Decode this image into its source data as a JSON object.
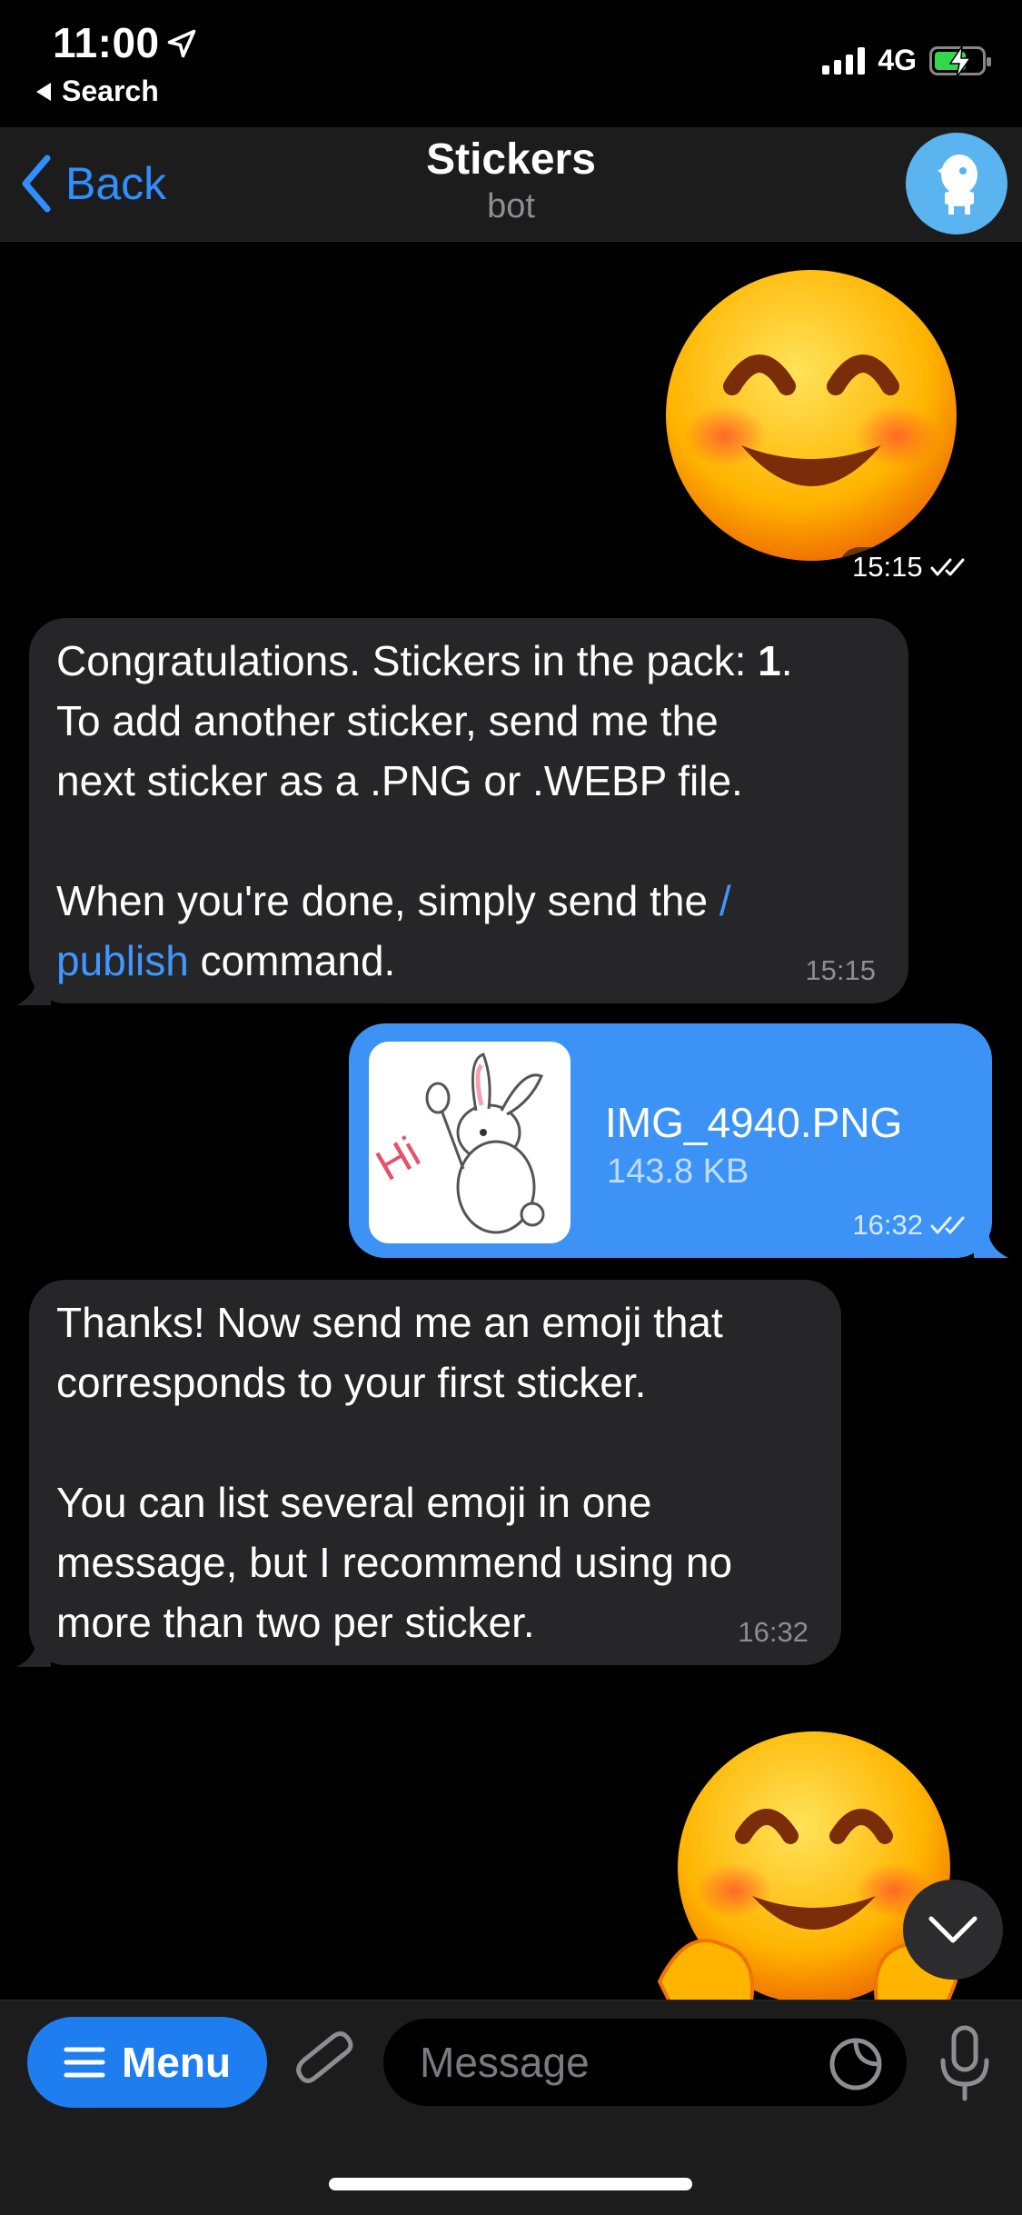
{
  "status_bar": {
    "time": "11:00",
    "back_app": "Search",
    "network": "4G"
  },
  "nav": {
    "back_label": "Back",
    "title": "Stickers",
    "subtitle": "bot"
  },
  "messages": [
    {
      "type": "sticker",
      "direction": "out",
      "emoji": "😊",
      "time": "15:15",
      "read": true
    },
    {
      "type": "text",
      "direction": "in",
      "lines": [
        "Congratulations. Stickers in the pack: ",
        "1",
        ".",
        "To add another sticker, send me the",
        "next sticker as a .PNG or .WEBP file.",
        "When you're done, simply send the ",
        "/",
        "publish",
        " command."
      ],
      "time": "15:15"
    },
    {
      "type": "file",
      "direction": "out",
      "file_name": "IMG_4940.PNG",
      "file_size": "143.8 KB",
      "thumb_text": "Hi",
      "time": "16:32",
      "read": true
    },
    {
      "type": "text",
      "direction": "in",
      "lines": [
        "Thanks! Now send me an emoji that",
        "corresponds to your first sticker.",
        "You can list several emoji in one",
        "message, but I recommend using no",
        "more than two per sticker."
      ],
      "time": "16:32"
    },
    {
      "type": "sticker",
      "direction": "out",
      "emoji": "🤗"
    }
  ],
  "input_bar": {
    "menu_label": "Menu",
    "placeholder": "Message"
  },
  "colors": {
    "accent": "#3d93f5",
    "incoming_bubble": "#262628",
    "link": "#3f97ff",
    "battery": "#32d74b"
  }
}
